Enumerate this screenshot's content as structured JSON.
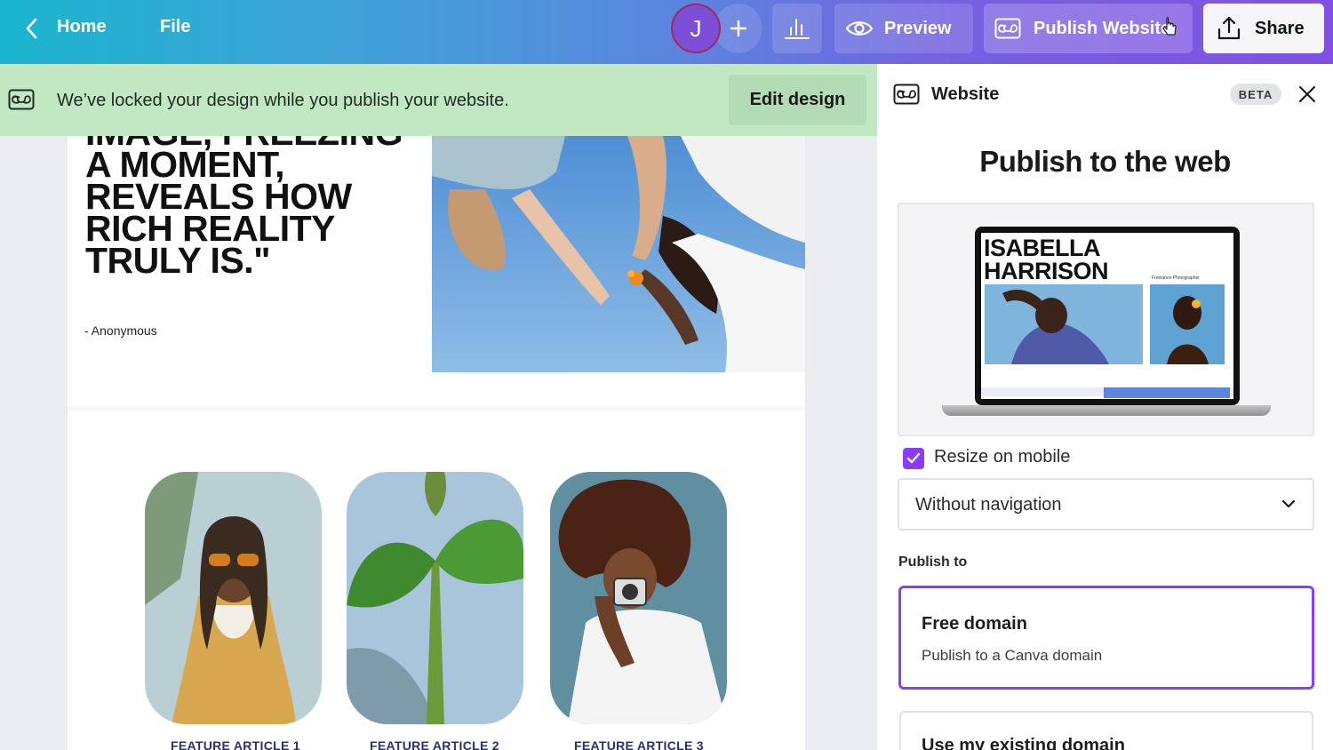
{
  "topbar": {
    "home_label": "Home",
    "file_label": "File",
    "avatar_initial": "J",
    "preview_label": "Preview",
    "publish_label": "Publish Website",
    "share_label": "Share",
    "gradient_start": "#1bb5cf",
    "gradient_end": "#8150e2"
  },
  "banner": {
    "message": "We’ve locked your design while you publish your website.",
    "edit_label": "Edit design",
    "background": "#c1e8c2"
  },
  "canvas": {
    "quote": "IMAGE, FREEZING A MOMENT, REVEALS HOW RICH REALITY TRULY IS.\"",
    "quote_author": "- Anonymous",
    "features": [
      {
        "title": "FEATURE ARTICLE 1"
      },
      {
        "title": "FEATURE ARTICLE 2"
      },
      {
        "title": "FEATURE ARTICLE 3"
      }
    ]
  },
  "panel": {
    "title": "Website",
    "badge": "BETA",
    "heading": "Publish to the web",
    "preview": {
      "site_name": "ISABELLA HARRISON",
      "site_tagline": "Freelance Photographer"
    },
    "resize_label": "Resize on mobile",
    "resize_checked": true,
    "navigation_select": "Without navigation",
    "publish_to_label": "Publish to",
    "options": [
      {
        "title": "Free domain",
        "description": "Publish to a Canva domain",
        "selected": true
      },
      {
        "title": "Use my existing domain",
        "selected": false
      }
    ],
    "accent_color": "#8b3dff"
  }
}
